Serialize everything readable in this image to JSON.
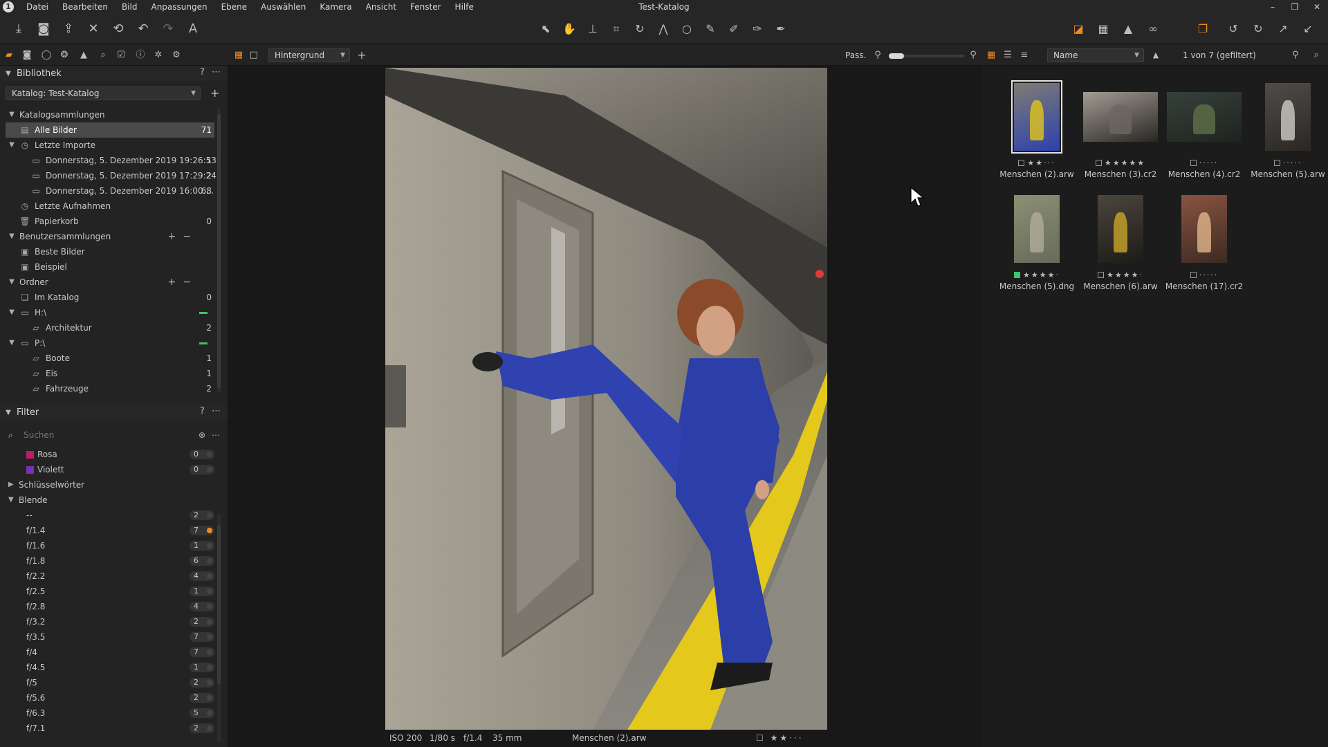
{
  "window": {
    "title": "Test-Katalog",
    "controls": [
      "–",
      "❐",
      "✕"
    ]
  },
  "menu": [
    "Datei",
    "Bearbeiten",
    "Bild",
    "Anpassungen",
    "Ebene",
    "Auswählen",
    "Kamera",
    "Ansicht",
    "Fenster",
    "Hilfe"
  ],
  "library": {
    "title": "Bibliothek",
    "header_actions": "? ⋯",
    "catalog_select": "Katalog: Test-Katalog",
    "catalog_collections": "Katalogsammlungen",
    "all_images": "Alle Bilder",
    "all_images_count": "71",
    "recent_imports": "Letzte Importe",
    "imports": [
      {
        "label": "Donnerstag, 5. Dezember 2019 19:26:53",
        "count": "1"
      },
      {
        "label": "Donnerstag, 5. Dezember 2019 17:29:24",
        "count": "2"
      },
      {
        "label": "Donnerstag, 5. Dezember 2019 16:00:...",
        "count": "68"
      }
    ],
    "recent_captures": "Letzte Aufnahmen",
    "trash": "Papierkorb",
    "trash_count": "0",
    "user_collections": "Benutzersammlungen",
    "best_images": "Beste Bilder",
    "example": "Beispiel",
    "folders": "Ordner",
    "in_catalog": "Im Katalog",
    "in_catalog_count": "0",
    "drive_h": "H:\\",
    "architektur": "Architektur",
    "architektur_count": "2",
    "drive_p": "P:\\",
    "boote": "Boote",
    "boote_count": "1",
    "eis": "Eis",
    "eis_count": "1",
    "fahrzeuge": "Fahrzeuge",
    "fahrzeuge_count": "2"
  },
  "filter": {
    "title": "Filter",
    "header_actions": "? ⋯",
    "search_placeholder": "Suchen",
    "colors": [
      {
        "label": "Rosa",
        "count": "0",
        "color": "#c2186b"
      },
      {
        "label": "Violett",
        "count": "0",
        "color": "#7a2fb5"
      }
    ],
    "keywords": "Schlüsselwörter",
    "aperture": "Blende",
    "apertures": [
      {
        "label": "--",
        "count": "2"
      },
      {
        "label": "f/1.4",
        "count": "7"
      },
      {
        "label": "f/1.6",
        "count": "1"
      },
      {
        "label": "f/1.8",
        "count": "6"
      },
      {
        "label": "f/2.2",
        "count": "4"
      },
      {
        "label": "f/2.5",
        "count": "1"
      },
      {
        "label": "f/2.8",
        "count": "4"
      },
      {
        "label": "f/3.2",
        "count": "2"
      },
      {
        "label": "f/3.5",
        "count": "7"
      },
      {
        "label": "f/4",
        "count": "7"
      },
      {
        "label": "f/4.5",
        "count": "1"
      },
      {
        "label": "f/5",
        "count": "2"
      },
      {
        "label": "f/5.6",
        "count": "2"
      },
      {
        "label": "f/6.3",
        "count": "5"
      },
      {
        "label": "f/7.1",
        "count": "2"
      }
    ]
  },
  "viewer": {
    "layer_select": "Hintergrund",
    "fit_label": "Pass.",
    "info": {
      "iso": "ISO 200",
      "shutter": "1/80 s",
      "aperture": "f/1.4",
      "focal": "35 mm",
      "filename": "Menschen (2).arw"
    },
    "rating": 2
  },
  "browser": {
    "sort_select": "Name",
    "count_label": "1 von 7 (gefiltert)",
    "thumbnails": [
      {
        "name": "Menschen (2).arw",
        "rating": 2,
        "tag": false
      },
      {
        "name": "Menschen (3).cr2",
        "rating": 5,
        "tag": false
      },
      {
        "name": "Menschen (4).cr2",
        "rating": 0,
        "tag": false
      },
      {
        "name": "Menschen (5).arw",
        "rating": 0,
        "tag": false
      },
      {
        "name": "Menschen (5).dng",
        "rating": 4,
        "tag": true
      },
      {
        "name": "Menschen (6).arw",
        "rating": 4,
        "tag": false
      },
      {
        "name": "Menschen (17).cr2",
        "rating": 0,
        "tag": false
      }
    ]
  },
  "colors": {
    "accent": "#f08a24",
    "status_green": "#3ec26a",
    "selection": "#4a4a4a"
  }
}
